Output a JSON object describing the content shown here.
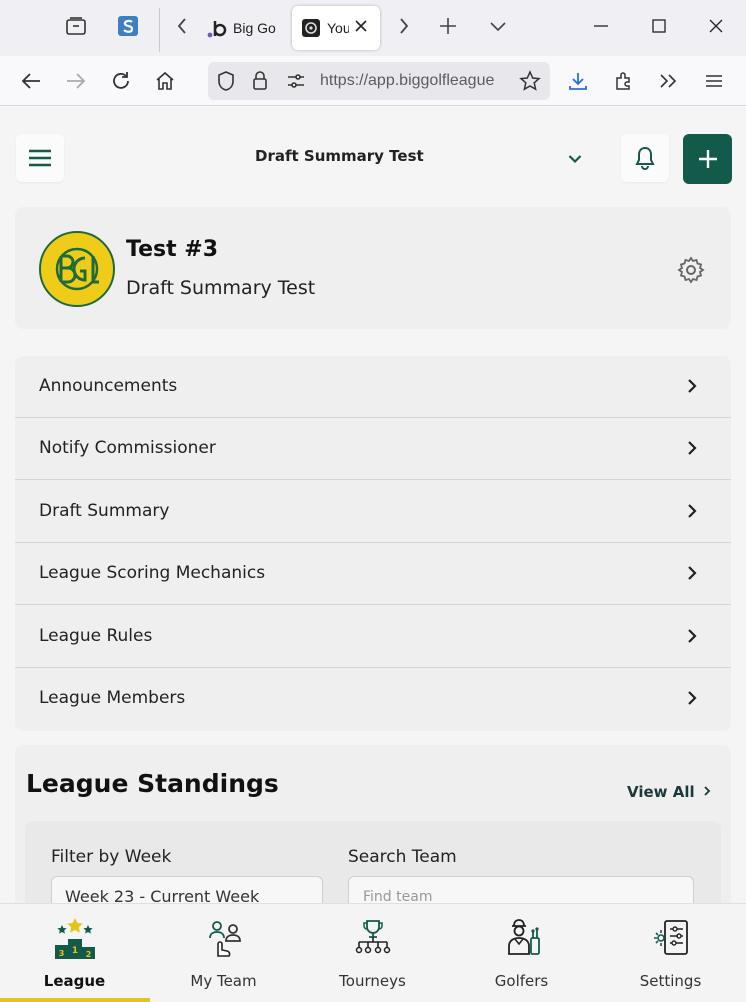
{
  "browser": {
    "tabs": [
      {
        "label": "Big Go"
      },
      {
        "label": "You"
      }
    ],
    "url": "https://app.biggolfleague"
  },
  "header": {
    "selected_league": "Draft Summary Test"
  },
  "league_card": {
    "name": "Test #3",
    "subtitle": "Draft Summary Test",
    "logo_text": "BGL"
  },
  "menu": {
    "items": [
      {
        "label": "Announcements"
      },
      {
        "label": "Notify Commissioner"
      },
      {
        "label": "Draft Summary"
      },
      {
        "label": "League Scoring Mechanics"
      },
      {
        "label": "League Rules"
      },
      {
        "label": "League Members"
      }
    ]
  },
  "standings": {
    "title": "League Standings",
    "view_all": "View All",
    "filter_label": "Filter by Week",
    "filter_value": "Week 23 - Current Week",
    "search_label": "Search Team",
    "search_placeholder": "Find team"
  },
  "bottom_nav": {
    "items": [
      {
        "label": "League",
        "icon": "podium-icon",
        "active": true
      },
      {
        "label": "My Team",
        "icon": "team-icon",
        "active": false
      },
      {
        "label": "Tourneys",
        "icon": "trophy-bracket-icon",
        "active": false
      },
      {
        "label": "Golfers",
        "icon": "golfer-icon",
        "active": false
      },
      {
        "label": "Settings",
        "icon": "settings-doc-icon",
        "active": false
      }
    ]
  },
  "colors": {
    "brand_green": "#135a4a",
    "accent_yellow": "#e6c417"
  }
}
